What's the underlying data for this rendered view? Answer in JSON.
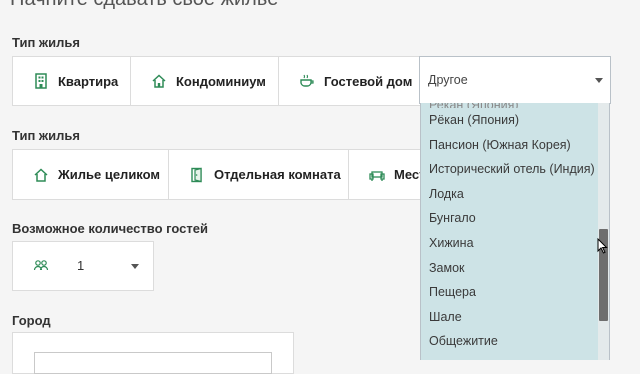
{
  "page": {
    "heading": "Начните сдавать свое жилье"
  },
  "property_type": {
    "label": "Тип жилья",
    "options": [
      {
        "label": "Квартира",
        "icon": "building-icon"
      },
      {
        "label": "Кондоминиум",
        "icon": "house-icon"
      },
      {
        "label": "Гостевой дом",
        "icon": "cup-icon"
      }
    ],
    "other_select": {
      "value": "Другое",
      "partial_top_item": "Рекан (Япония)",
      "items": [
        "Рёкан (Япония)",
        "Пансион (Южная Корея)",
        "Исторический отель (Индия)",
        "Лодка",
        "Бунгало",
        "Хижина",
        "Замок",
        "Пещера",
        "Шале",
        "Общежитие"
      ]
    }
  },
  "room_type": {
    "label": "Тип жилья",
    "options": [
      {
        "label": "Жилье целиком",
        "icon": "house-icon"
      },
      {
        "label": "Отдельная комната",
        "icon": "door-icon"
      },
      {
        "label": "Место",
        "icon": "sofa-icon"
      }
    ]
  },
  "guests": {
    "label": "Возможное количество гостей",
    "value": "1",
    "icon": "people-icon"
  },
  "city": {
    "label": "Город"
  },
  "colors": {
    "listbox_bg": "#cde3e6",
    "page_bg": "#f5f5f5",
    "border": "#dcdcdc"
  }
}
